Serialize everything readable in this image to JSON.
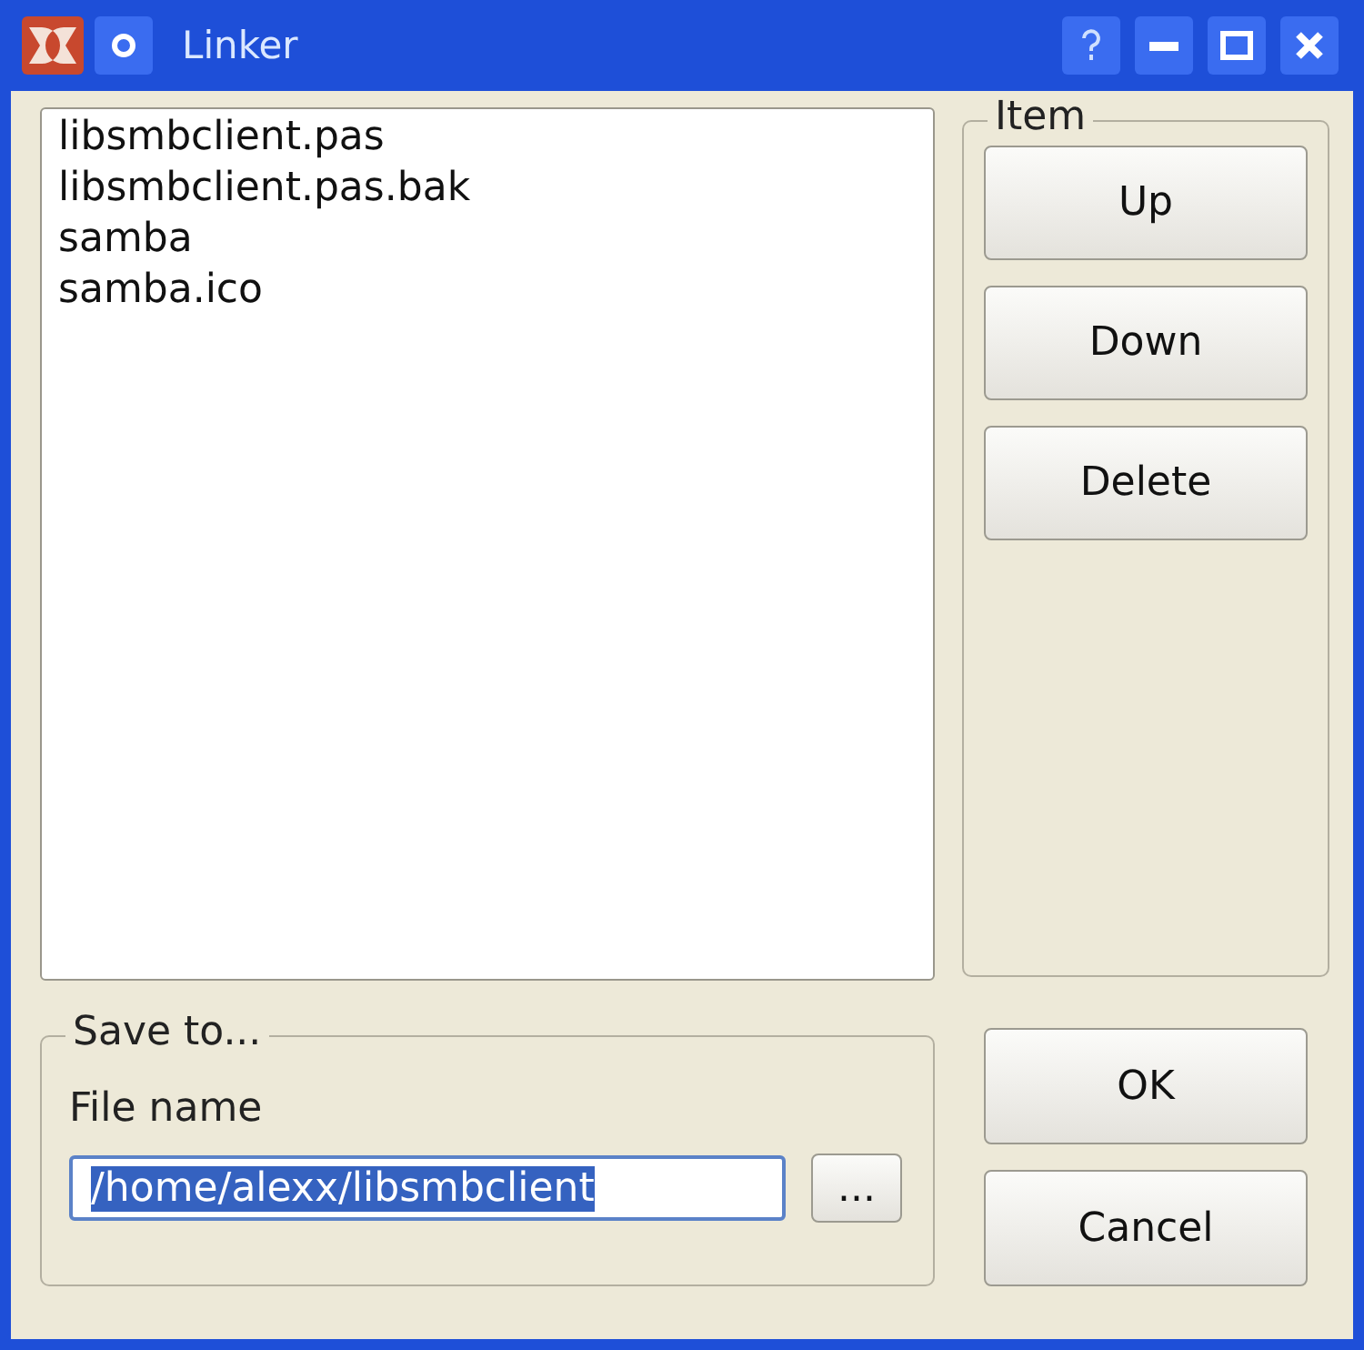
{
  "window": {
    "title": "Linker"
  },
  "files": [
    "libsmbclient.pas",
    "libsmbclient.pas.bak",
    "samba",
    "samba.ico"
  ],
  "item_group": {
    "title": "Item",
    "buttons": [
      "Up",
      "Down",
      "Delete"
    ]
  },
  "save_group": {
    "title": "Save to...",
    "label": "File name",
    "value": "/home/alexx/libsmbclient",
    "value_selected": true,
    "browse": "..."
  },
  "buttons": [
    "OK",
    "Cancel"
  ]
}
